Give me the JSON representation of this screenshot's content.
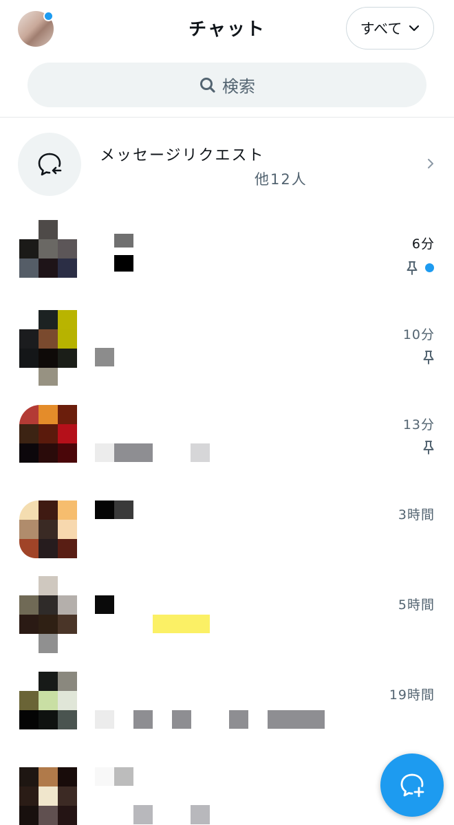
{
  "header": {
    "title": "チャット",
    "filter_label": "すべて"
  },
  "search": {
    "label": "検索"
  },
  "message_requests": {
    "title": "メッセージリクエスト",
    "subtitle": "他12人"
  },
  "chats": [
    {
      "time": "6分",
      "unread": true,
      "pinned": true
    },
    {
      "time": "10分",
      "unread": false,
      "pinned": true
    },
    {
      "time": "13分",
      "unread": false,
      "pinned": true
    },
    {
      "time": "3時間",
      "unread": false,
      "pinned": false
    },
    {
      "time": "5時間",
      "unread": false,
      "pinned": false
    },
    {
      "time": "19時間",
      "unread": false,
      "pinned": false
    },
    {
      "time": "",
      "unread": false,
      "pinned": false
    }
  ],
  "colors": {
    "accent": "#1d9bf0",
    "secondary_text": "#536471",
    "search_bg": "#eff3f4"
  },
  "icons": {
    "search": "search-icon",
    "chevron": "chevron-down-icon",
    "requests": "message-request-icon",
    "pin": "pin-icon",
    "compose": "new-message-icon"
  }
}
